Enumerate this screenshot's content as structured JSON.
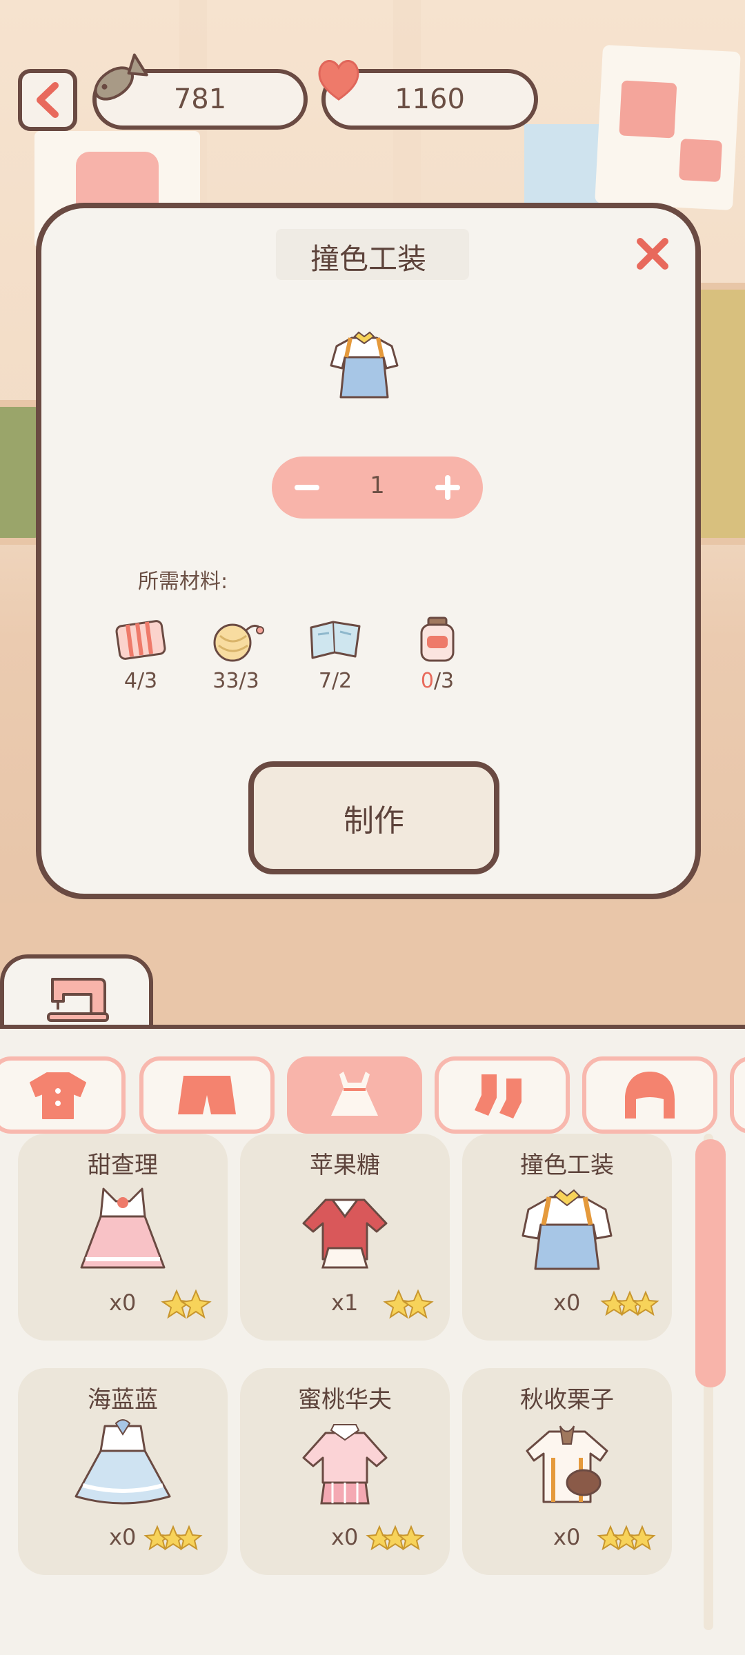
{
  "currency": {
    "fish_count": "781",
    "heart_count": "1160"
  },
  "modal": {
    "title": "撞色工装",
    "quantity": "1",
    "materials_label": "所需材料:",
    "materials": [
      {
        "icon": "striped-fabric-icon",
        "have": "4",
        "need": "3",
        "sufficient": true
      },
      {
        "icon": "yarn-ball-icon",
        "have": "33",
        "need": "3",
        "sufficient": true
      },
      {
        "icon": "pattern-paper-icon",
        "have": "7",
        "need": "2",
        "sufficient": true
      },
      {
        "icon": "button-jar-icon",
        "have": "0",
        "need": "3",
        "sufficient": false
      }
    ],
    "craft_label": "制作"
  },
  "categories": [
    {
      "icon": "shirt-icon",
      "active": false
    },
    {
      "icon": "shorts-icon",
      "active": false
    },
    {
      "icon": "dress-icon",
      "active": true
    },
    {
      "icon": "socks-icon",
      "active": false
    },
    {
      "icon": "hair-icon",
      "active": false
    }
  ],
  "items": [
    {
      "name": "甜查理",
      "count": "x0",
      "stars": 2
    },
    {
      "name": "苹果糖",
      "count": "x1",
      "stars": 2
    },
    {
      "name": "撞色工装",
      "count": "x0",
      "stars": 3
    },
    {
      "name": "海蓝蓝",
      "count": "x0",
      "stars": 3
    },
    {
      "name": "蜜桃华夫",
      "count": "x0",
      "stars": 3
    },
    {
      "name": "秋收栗子",
      "count": "x0",
      "stars": 3
    }
  ],
  "colors": {
    "accent_pink": "#f8b4aa",
    "outline_brown": "#6a4a42",
    "lack_red": "#e86b5c",
    "star_yellow": "#f7d35a"
  }
}
